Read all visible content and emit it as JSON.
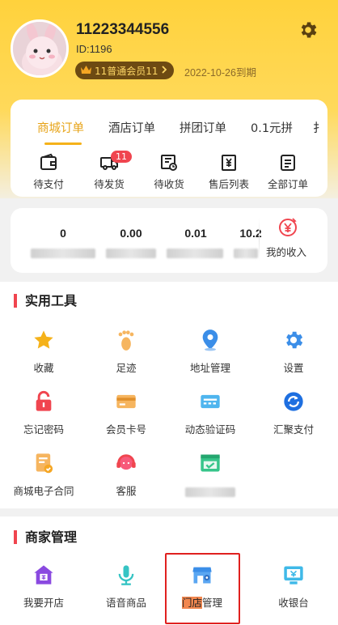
{
  "profile": {
    "username": "11223344556",
    "id_text": "ID:1196",
    "member_badge": "11普通会员11",
    "expiry": "2022-10-26到期"
  },
  "order_tabs": [
    "商城订单",
    "酒店订单",
    "拼团订单",
    "0.1元拼",
    "扌"
  ],
  "order_items": [
    {
      "label": "待支付",
      "icon": "wallet-icon"
    },
    {
      "label": "待发货",
      "icon": "truck-icon",
      "badge": "11"
    },
    {
      "label": "待收货",
      "icon": "receive-icon"
    },
    {
      "label": "售后列表",
      "icon": "yen-return-icon"
    },
    {
      "label": "全部订单",
      "icon": "document-icon"
    }
  ],
  "income": {
    "values": [
      "0",
      "0.00",
      "0.01",
      "10.2"
    ],
    "my_income_label": "我的收入"
  },
  "tools": {
    "title": "实用工具",
    "items": [
      {
        "label": "收藏",
        "icon": "star-icon"
      },
      {
        "label": "足迹",
        "icon": "footprint-icon"
      },
      {
        "label": "地址管理",
        "icon": "location-icon"
      },
      {
        "label": "设置",
        "icon": "gear-icon"
      },
      {
        "label": "忘记密码",
        "icon": "lock-icon"
      },
      {
        "label": "会员卡号",
        "icon": "card-icon"
      },
      {
        "label": "动态验证码",
        "icon": "captcha-icon"
      },
      {
        "label": "汇聚支付",
        "icon": "pay-icon"
      },
      {
        "label": "商城电子合同",
        "icon": "contract-icon"
      },
      {
        "label": "客服",
        "icon": "headset-icon"
      },
      {
        "label": "",
        "icon": "table-icon"
      }
    ]
  },
  "merchant": {
    "title": "商家管理",
    "items": [
      {
        "label": "我要开店",
        "icon": "shop-house-icon"
      },
      {
        "label": "语音商品",
        "icon": "microphone-icon"
      },
      {
        "label_highlight": "门店",
        "label_rest": "管理",
        "icon": "storefront-icon"
      },
      {
        "label": "收银台",
        "icon": "cashier-icon"
      }
    ]
  },
  "colors": {
    "header": "#ffd23c",
    "accent": "#e7a419",
    "red": "#f0454f",
    "blue": "#3b8ee8"
  }
}
